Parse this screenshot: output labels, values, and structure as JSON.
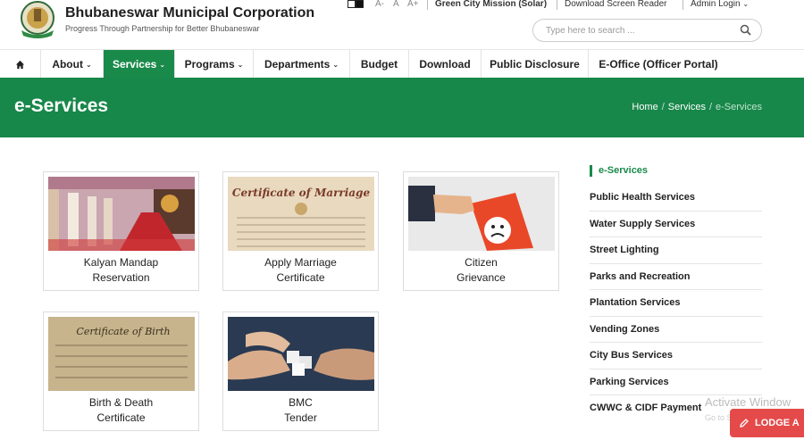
{
  "header": {
    "org_name": "Bhubaneswar Municipal Corporation",
    "tagline": "Progress Through Partnership for Better Bhubaneswar",
    "font_small": "A-",
    "font_normal": "A",
    "font_large": "A+",
    "green_city": "Green City Mission (Solar)",
    "screen_reader": "Download Screen Reader",
    "admin_login": "Admin Login",
    "search_placeholder": "Type here to search ..."
  },
  "nav": {
    "home_icon": "home-icon",
    "items": [
      {
        "label": "About",
        "caret": "⌄"
      },
      {
        "label": "Services",
        "caret": "⌄"
      },
      {
        "label": "Programs",
        "caret": "⌄"
      },
      {
        "label": "Departments",
        "caret": "⌄"
      },
      {
        "label": "Budget"
      },
      {
        "label": "Download"
      },
      {
        "label": "Public Disclosure"
      },
      {
        "label": "E-Office (Officer Portal)"
      }
    ]
  },
  "banner": {
    "title": "e-Services",
    "breadcrumb": [
      "Home",
      "Services",
      "e-Services"
    ]
  },
  "cards": [
    {
      "line1": "Kalyan Mandap",
      "line2": "Reservation"
    },
    {
      "line1": "Apply Marriage",
      "line2": "Certificate",
      "image_text": "Certificate of Marriage"
    },
    {
      "line1": "Citizen",
      "line2": "Grievance"
    },
    {
      "line1": "Birth & Death",
      "line2": "Certificate",
      "image_text": "Certificate of Birth"
    },
    {
      "line1": "BMC",
      "line2": "Tender"
    }
  ],
  "sidebar": {
    "heading": "e-Services",
    "items": [
      "Public Health Services",
      "Water Supply Services",
      "Street Lighting",
      "Parks and Recreation",
      "Plantation Services",
      "Vending Zones",
      "City Bus Services",
      "Parking Services",
      "CWWC & CIDF Payment"
    ]
  },
  "overlay": {
    "watermark": "Activate Window",
    "watermark_sub": "Go to Se",
    "lodge_button": "LODGE A"
  },
  "colors": {
    "brand_green": "#1a8a4b",
    "lodge_red": "#e44a4a"
  }
}
